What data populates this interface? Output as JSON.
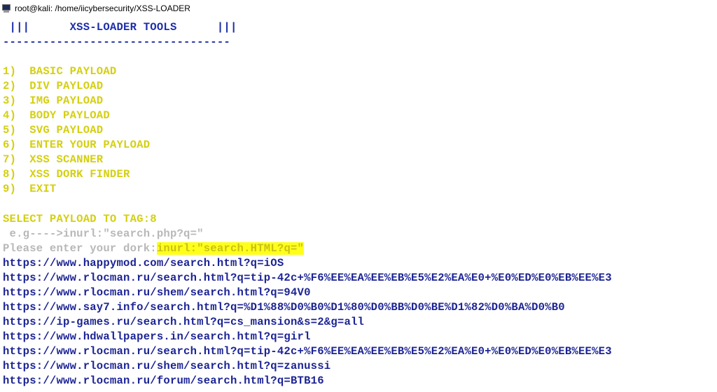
{
  "window": {
    "title": "root@kali: /home/iicybersecurity/XSS-LOADER"
  },
  "banner": {
    "title_line": " |||      XSS-LOADER TOOLS      |||",
    "separator": "----------------------------------"
  },
  "menu": {
    "items": [
      "1)  BASIC PAYLOAD",
      "2)  DIV PAYLOAD",
      "3)  IMG PAYLOAD",
      "4)  BODY PAYLOAD",
      "5)  SVG PAYLOAD",
      "6)  ENTER YOUR PAYLOAD",
      "7)  XSS SCANNER",
      "8)  XSS DORK FINDER",
      "9)  EXIT"
    ]
  },
  "prompt": {
    "select": "SELECT PAYLOAD TO TAG:8",
    "example": " e.g---->inurl:\"search.php?q=\"",
    "dork_label": "Please enter your dork:",
    "dork_value": "inurl:\"search.HTML?q=\""
  },
  "results": [
    "https://www.happymod.com/search.html?q=iOS",
    "https://www.rlocman.ru/search.html?q=tip-42c+%F6%EE%EA%EE%EB%E5%E2%EA%E0+%E0%ED%E0%EB%EE%E3",
    "https://www.rlocman.ru/shem/search.html?q=94V0",
    "https://www.say7.info/search.html?q=%D1%88%D0%B0%D1%80%D0%BB%D0%BE%D1%82%D0%BA%D0%B0",
    "https://ip-games.ru/search.html?q=cs_mansion&s=2&g=all",
    "https://www.hdwallpapers.in/search.html?q=girl",
    "https://www.rlocman.ru/search.html?q=tip-42c+%F6%EE%EA%EE%EB%E5%E2%EA%E0+%E0%ED%E0%EB%EE%E3",
    "https://www.rlocman.ru/shem/search.html?q=zanussi",
    "https://www.rlocman.ru/forum/search.html?q=BTB16"
  ]
}
